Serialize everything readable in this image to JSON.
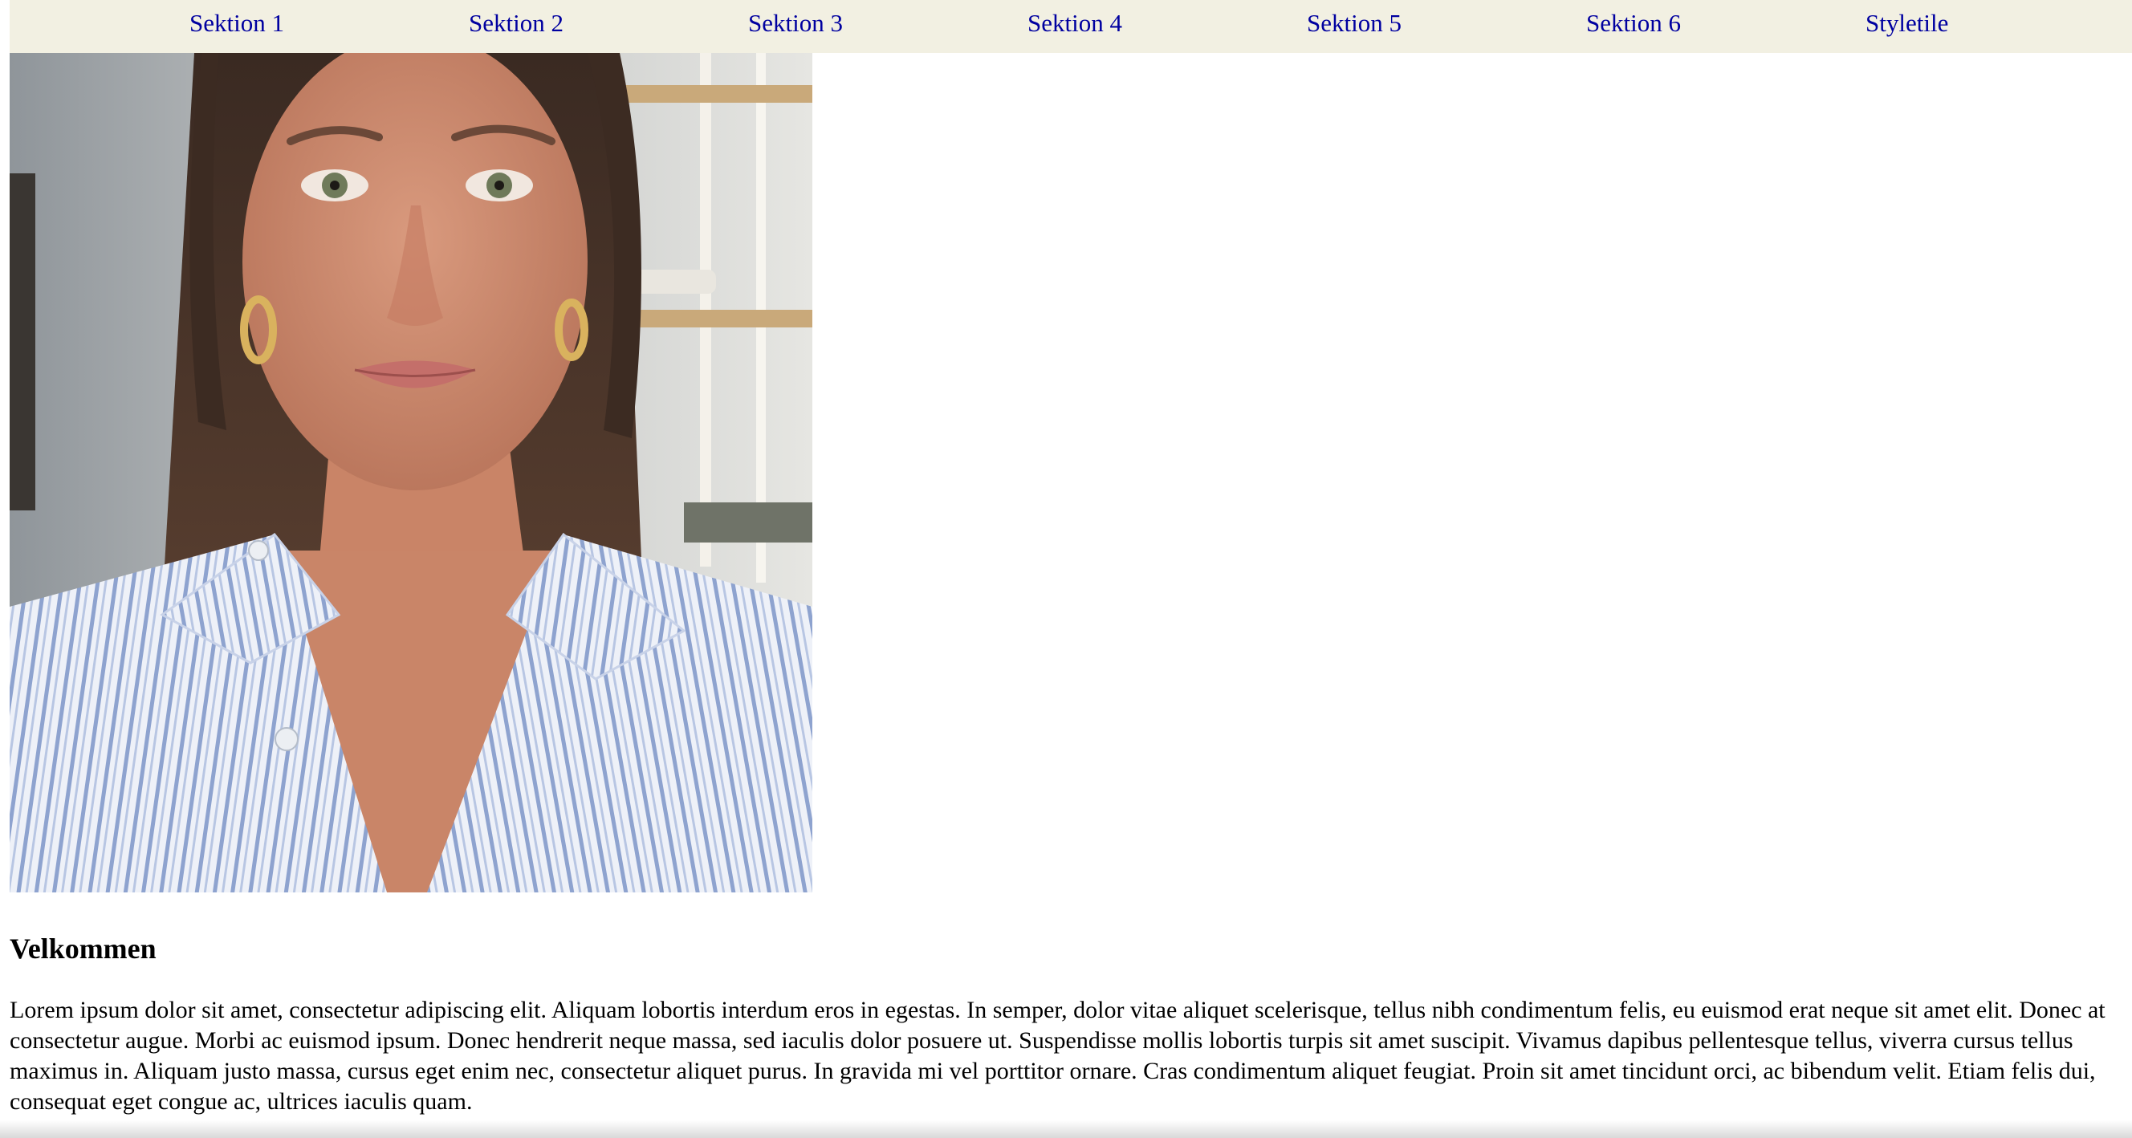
{
  "nav": {
    "items": [
      {
        "label": "Sektion 1"
      },
      {
        "label": "Sektion 2"
      },
      {
        "label": "Sektion 3"
      },
      {
        "label": "Sektion 4"
      },
      {
        "label": "Sektion 5"
      },
      {
        "label": "Sektion 6"
      },
      {
        "label": "Styletile"
      }
    ]
  },
  "main": {
    "heading": "Velkommen",
    "paragraph": "Lorem ipsum dolor sit amet, consectetur adipiscing elit. Aliquam lobortis interdum eros in egestas. In semper, dolor vitae aliquet scelerisque, tellus nibh condimentum felis, eu euismod erat neque sit amet elit. Donec at consectetur augue. Morbi ac euismod ipsum. Donec hendrerit neque massa, sed iaculis dolor posuere ut. Suspendisse mollis lobortis turpis sit amet suscipit. Vivamus dapibus pellentesque tellus, viverra cursus tellus maximus in. Aliquam justo massa, cursus eget enim nec, consectetur aliquet purus. In gravida mi vel porttitor ornare. Cras condimentum aliquet feugiat. Proin sit amet tincidunt orci, ac bibendum velit. Etiam felis dui, consequat eget congue ac, ultrices iaculis quam."
  },
  "colors": {
    "nav_background": "#f2f0e2",
    "link": "#0000a0",
    "text": "#000000"
  }
}
